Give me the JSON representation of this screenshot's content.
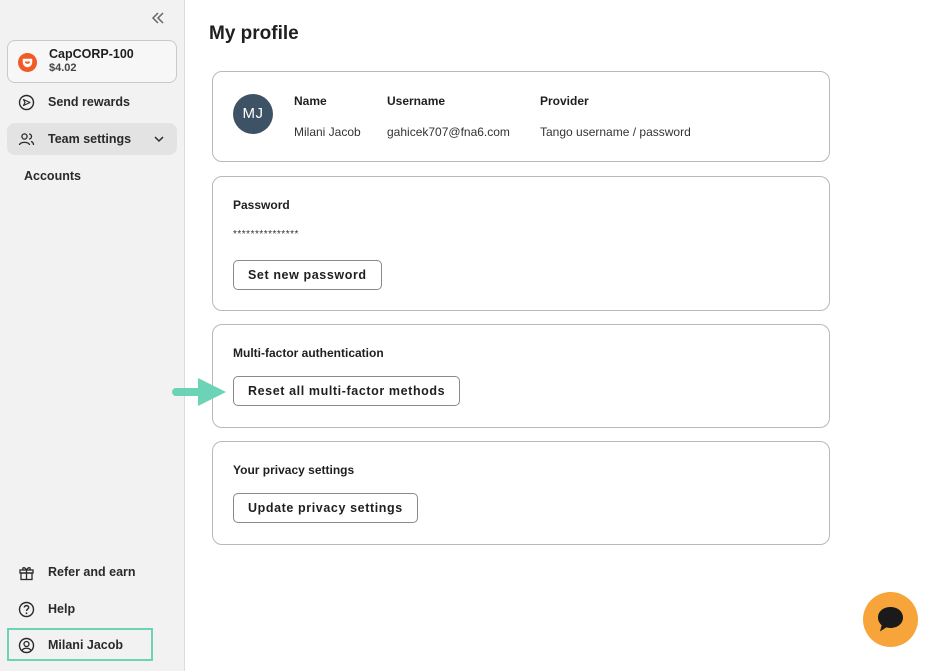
{
  "sidebar": {
    "account": {
      "name": "CapCORP-100",
      "balance": "$4.02"
    },
    "items": [
      {
        "label": "Send rewards",
        "icon": "send-icon"
      },
      {
        "label": "Team settings",
        "icon": "team-icon"
      }
    ],
    "sub_items": [
      {
        "label": "Accounts"
      }
    ],
    "bottom_items": [
      {
        "label": "Refer and earn",
        "icon": "gift-icon"
      },
      {
        "label": "Help",
        "icon": "help-icon"
      }
    ],
    "user": {
      "label": "Milani Jacob",
      "icon": "user-icon"
    }
  },
  "main": {
    "title": "My profile",
    "profile": {
      "initials": "MJ",
      "columns": [
        {
          "header": "Name",
          "value": "Milani Jacob"
        },
        {
          "header": "Username",
          "value": "gahicek707@fna6.com"
        },
        {
          "header": "Provider",
          "value": "Tango username / password"
        }
      ]
    },
    "password": {
      "heading": "Password",
      "masked": "***************",
      "button": "Set new password"
    },
    "mfa": {
      "heading": "Multi-factor authentication",
      "button": "Reset all multi-factor methods"
    },
    "privacy": {
      "heading": "Your privacy settings",
      "button": "Update privacy settings"
    }
  },
  "colors": {
    "accent_orange": "#f15a24",
    "chat_orange": "#f7a53b",
    "highlight_teal": "#6dd3b6",
    "avatar_bg": "#3e5266"
  }
}
